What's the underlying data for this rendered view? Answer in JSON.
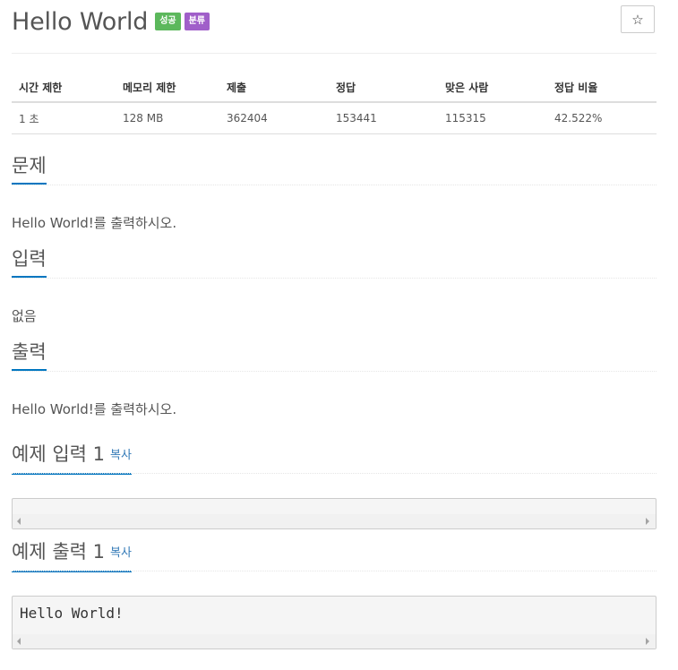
{
  "problem": {
    "title": "Hello World",
    "badges": {
      "success": "성공",
      "category": "분류"
    },
    "star_icon": "☆"
  },
  "info": {
    "headers": [
      "시간 제한",
      "메모리 제한",
      "제출",
      "정답",
      "맞은 사람",
      "정답 비율"
    ],
    "values": [
      "1 초",
      "128 MB",
      "362404",
      "153441",
      "115315",
      "42.522%"
    ]
  },
  "sections": {
    "description": {
      "title": "문제",
      "text": "Hello World!를 출력하시오."
    },
    "input": {
      "title": "입력",
      "text": "없음"
    },
    "output": {
      "title": "출력",
      "text": "Hello World!를 출력하시오."
    },
    "sample_input": {
      "title": "예제 입력 1",
      "copy": "복사",
      "content": ""
    },
    "sample_output": {
      "title": "예제 출력 1",
      "copy": "복사",
      "content": "Hello World!"
    }
  },
  "colors": {
    "success_badge": "#5cb85c",
    "category_badge": "#a05fc9",
    "heading_underline": "#0076c0",
    "link": "#337ab7"
  }
}
